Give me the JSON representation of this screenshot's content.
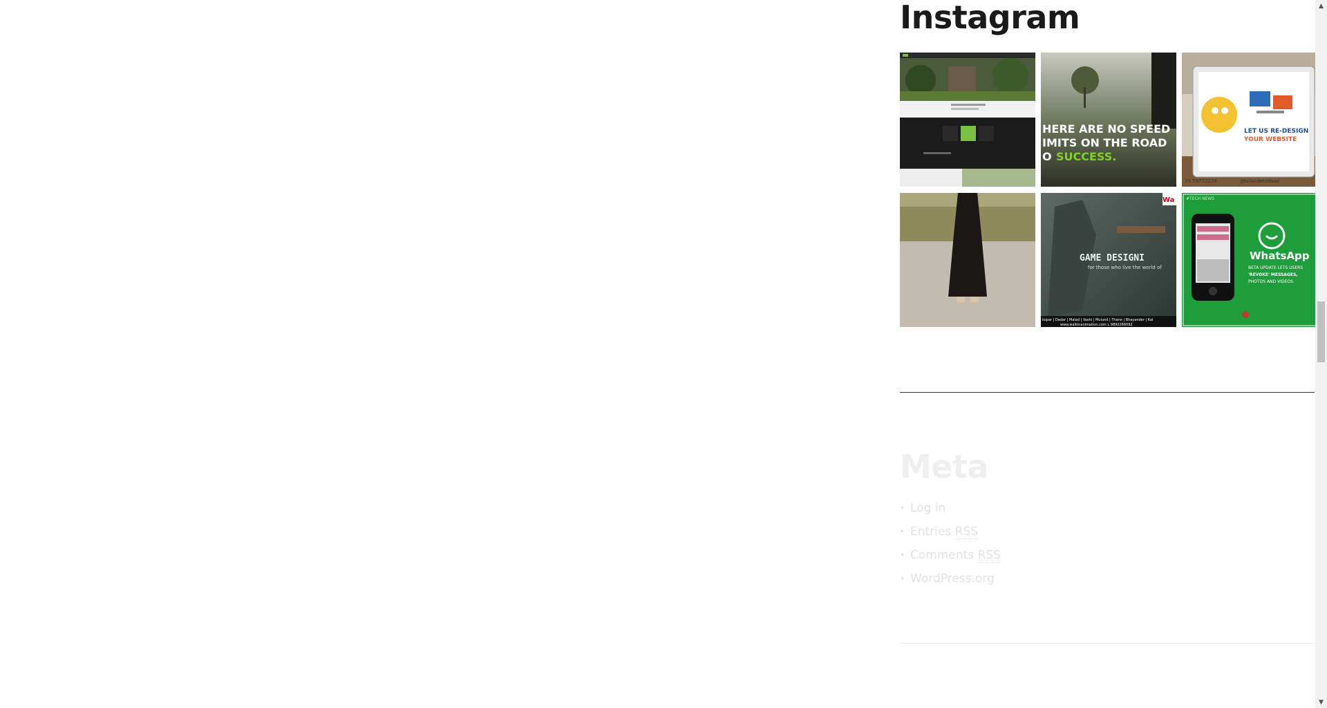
{
  "instagram": {
    "title": "Instagram",
    "tiles": [
      {
        "name": "green-website-screenshot"
      },
      {
        "name": "speed-limits-quote",
        "line1": "HERE ARE NO SPEED",
        "line2": "IMITS ON THE ROAD",
        "line3": "O ",
        "line3_accent": "SUCCESS.",
        "accent": "#7ed321"
      },
      {
        "name": "laptop-redesign-ad",
        "line1": "LET US RE-DESIGN",
        "line2": "YOUR WEBSITE",
        "phone": "73 59772224",
        "handle": "@bellandwhistlead"
      },
      {
        "name": "person-in-park"
      },
      {
        "name": "game-design-ad",
        "headline": "GAME DESIGNI",
        "tagline": "for those who live the world of",
        "locations": "kopar | Dadar | Malad | Vashi | Mulund | Thane | Bhayander | Kal",
        "site": "www.walkinanimation.com   L 9892266092",
        "brand": "Wa"
      },
      {
        "name": "whatsapp-news",
        "badge": "#TECH NEWS",
        "headline": "WhatsApp",
        "sub1": "BETA UPDATE LETS USERS",
        "sub2": "'REVOKE' MESSAGES,",
        "sub3": "PHOTOS AND VIDEOS.",
        "bg": "#1e9e3a"
      }
    ]
  },
  "meta": {
    "title": "Meta",
    "links": [
      {
        "label": "Log in"
      },
      {
        "label": "Entries ",
        "abbr": "RSS"
      },
      {
        "label": "Comments ",
        "abbr": "RSS"
      },
      {
        "label": "WordPress.org"
      }
    ]
  },
  "scrollbar": {
    "up_arrow": "▲",
    "down_arrow": "▼"
  }
}
